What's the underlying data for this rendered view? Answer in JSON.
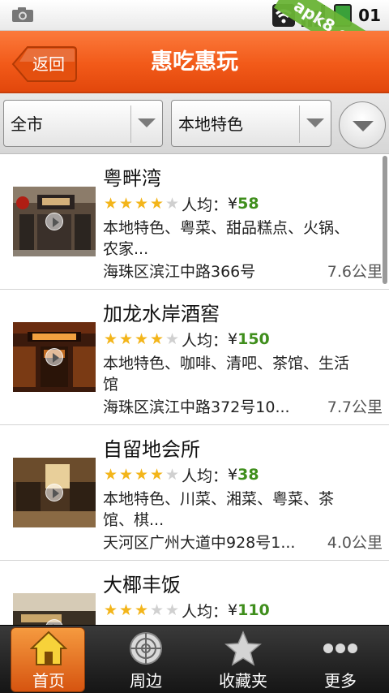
{
  "status_bar": {
    "time": "01",
    "watermark": "apk8.com"
  },
  "header": {
    "back_label": "返回",
    "title": "惠吃惠玩"
  },
  "filters": {
    "area": "全市",
    "category": "本地特色"
  },
  "restaurants": [
    {
      "name": "粤畔湾",
      "stars": 4,
      "avg_label": "人均：",
      "currency": "¥",
      "price": "58",
      "tags": "本地特色、粤菜、甜品糕点、火锅、农家...",
      "address": "海珠区滨江中路366号",
      "distance": "7.6公里"
    },
    {
      "name": "加龙水岸酒窖",
      "stars": 4,
      "avg_label": "人均：",
      "currency": "¥",
      "price": "150",
      "tags": "本地特色、咖啡、清吧、茶馆、生活馆",
      "address": "海珠区滨江中路372号10...",
      "distance": "7.7公里"
    },
    {
      "name": "自留地会所",
      "stars": 4,
      "avg_label": "人均：",
      "currency": "¥",
      "price": "38",
      "tags": "本地特色、川菜、湘菜、粤菜、茶馆、棋...",
      "address": "天河区广州大道中928号1...",
      "distance": "4.0公里"
    },
    {
      "name": "大椰丰饭",
      "stars": 3,
      "avg_label": "人均：",
      "currency": "¥",
      "price": "110",
      "tags": "",
      "address": "",
      "distance": ""
    }
  ],
  "tabs": [
    {
      "label": "首页",
      "icon": "home-icon",
      "active": true
    },
    {
      "label": "周边",
      "icon": "radar-icon",
      "active": false
    },
    {
      "label": "收藏夹",
      "icon": "star-icon",
      "active": false
    },
    {
      "label": "更多",
      "icon": "more-icon",
      "active": false
    }
  ],
  "colors": {
    "accent": "#f25a19",
    "price": "#3f8e1c",
    "star_on": "#f3b51a",
    "star_off": "#d0d0d0"
  }
}
